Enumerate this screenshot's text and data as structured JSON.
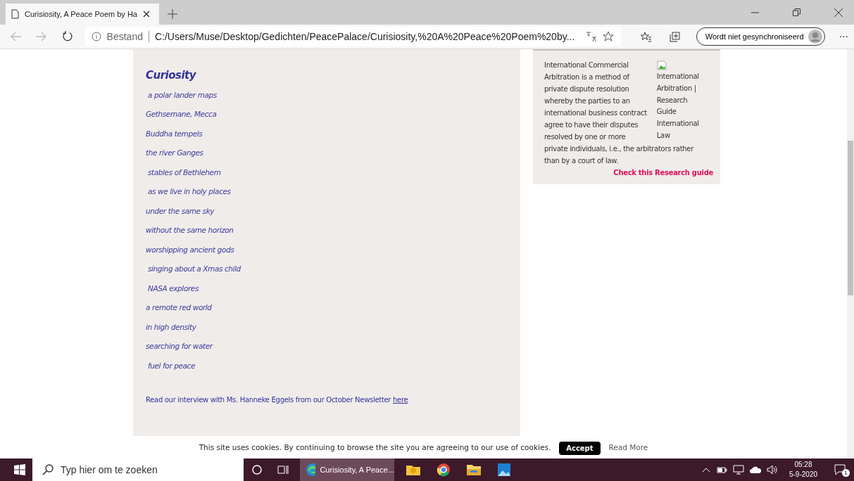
{
  "browser": {
    "tab": {
      "title": "Curisiosity, A Peace Poem by Ha",
      "selected": true
    },
    "address": {
      "security": "Bestand",
      "url": "C:/Users/Muse/Desktop/Gedichten/PeacePalace/Curisiosity,%20A%20Peace%20Poem%20by..."
    },
    "sync_button": "Wordt niet gesynchroniseerd",
    "more": "···"
  },
  "poem": {
    "title": "Curiosity",
    "lines": [
      {
        "text": "a polar lander maps",
        "indent": true
      },
      {
        "text": "Gethsemane, Mecca",
        "indent": false
      },
      {
        "text": "Buddha tempels",
        "indent": false
      },
      {
        "text": "the river Ganges",
        "indent": false
      },
      {
        "text": "stables of Bethlehem",
        "indent": true
      },
      {
        "text": "as we live in holy places",
        "indent": true
      },
      {
        "text": "under the same sky",
        "indent": false
      },
      {
        "text": "without the same horizon",
        "indent": false
      },
      {
        "text": "worshipping ancient gods",
        "indent": false
      },
      {
        "text": "singing about a Xmas child",
        "indent": true
      },
      {
        "text": "NASA explores",
        "indent": true
      },
      {
        "text": "a remote red world",
        "indent": false
      },
      {
        "text": "in high density",
        "indent": false
      },
      {
        "text": "searching for water",
        "indent": false
      },
      {
        "text": "fuel for peace",
        "indent": true
      }
    ],
    "note": "Read our interview with Ms. Hanneke Eggels from our October Newsletter",
    "note_link": "here"
  },
  "sidebar": {
    "text_beside_image": [
      "International Commercial",
      "Arbitration is a method of",
      "private dispute resolution",
      "whereby the parties to an",
      "international business contract",
      "agree to have their disputes",
      "resolved by one or more"
    ],
    "text_below": [
      "private individuals, i.e., the arbitrators rather",
      "than by a court of law."
    ],
    "image_alt": "International Arbitration | Research Guide International Law",
    "link": "Check this Research guide"
  },
  "cookie_bar": {
    "text": "This site uses cookies. By continuing to browse the site you are agreeing to our use of cookies.",
    "accept": "Accept",
    "read_more": "Read More"
  },
  "taskbar": {
    "search_placeholder": "Typ hier om te zoeken",
    "app": "Curisiosity, A Peace...",
    "time": "05:28",
    "date": "5-9-2020",
    "notifications": "1"
  }
}
